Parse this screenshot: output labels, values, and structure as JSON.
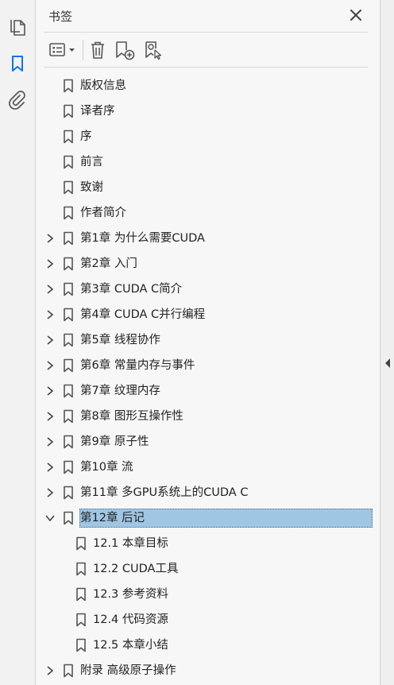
{
  "panel": {
    "title": "书签"
  },
  "colors": {
    "accent": "#1473e6",
    "selection": "#9fc6e3",
    "icon": "#555555"
  },
  "rail": {
    "items": [
      {
        "icon": "pages-icon"
      },
      {
        "icon": "bookmark-icon",
        "active": true
      },
      {
        "icon": "attachment-icon"
      }
    ]
  },
  "toolbar": {
    "items": [
      {
        "icon": "options-menu-icon"
      },
      {
        "icon": "delete-icon"
      },
      {
        "icon": "new-bookmark-icon"
      },
      {
        "icon": "bookmark-search-icon"
      }
    ]
  },
  "bookmarks": [
    {
      "label": "版权信息",
      "level": 0,
      "expander": "none"
    },
    {
      "label": "译者序",
      "level": 0,
      "expander": "none"
    },
    {
      "label": "序",
      "level": 0,
      "expander": "none"
    },
    {
      "label": "前言",
      "level": 0,
      "expander": "none"
    },
    {
      "label": "致谢",
      "level": 0,
      "expander": "none"
    },
    {
      "label": "作者简介",
      "level": 0,
      "expander": "none"
    },
    {
      "label": "第1章 为什么需要CUDA",
      "level": 0,
      "expander": "collapsed"
    },
    {
      "label": "第2章 入门",
      "level": 0,
      "expander": "collapsed"
    },
    {
      "label": "第3章 CUDA C简介",
      "level": 0,
      "expander": "collapsed"
    },
    {
      "label": "第4章 CUDA C并行编程",
      "level": 0,
      "expander": "collapsed"
    },
    {
      "label": "第5章 线程协作",
      "level": 0,
      "expander": "collapsed"
    },
    {
      "label": "第6章 常量内存与事件",
      "level": 0,
      "expander": "collapsed"
    },
    {
      "label": "第7章 纹理内存",
      "level": 0,
      "expander": "collapsed"
    },
    {
      "label": "第8章 图形互操作性",
      "level": 0,
      "expander": "collapsed"
    },
    {
      "label": "第9章 原子性",
      "level": 0,
      "expander": "collapsed"
    },
    {
      "label": "第10章 流",
      "level": 0,
      "expander": "collapsed"
    },
    {
      "label": "第11章 多GPU系统上的CUDA C",
      "level": 0,
      "expander": "collapsed"
    },
    {
      "label": "第12章 后记",
      "level": 0,
      "expander": "expanded",
      "selected": true
    },
    {
      "label": "12.1 本章目标",
      "level": 1,
      "expander": "none"
    },
    {
      "label": "12.2 CUDA工具",
      "level": 1,
      "expander": "none"
    },
    {
      "label": "12.3 参考资料",
      "level": 1,
      "expander": "none"
    },
    {
      "label": "12.4 代码资源",
      "level": 1,
      "expander": "none"
    },
    {
      "label": "12.5 本章小结",
      "level": 1,
      "expander": "none"
    },
    {
      "label": "附录 高级原子操作",
      "level": 0,
      "expander": "collapsed"
    }
  ]
}
